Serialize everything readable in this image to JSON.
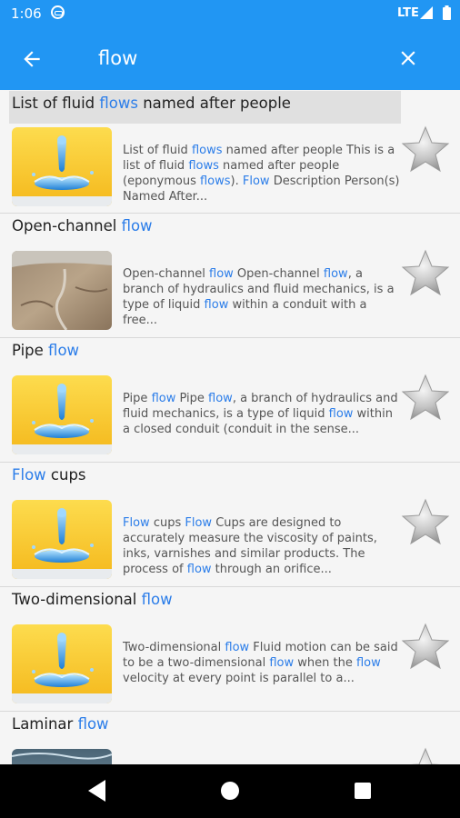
{
  "status_bar": {
    "time": "1:06",
    "network": "LTE"
  },
  "search": {
    "query": "flow",
    "back_icon": "arrow-left-icon",
    "clear_icon": "close-icon"
  },
  "colors": {
    "primary": "#2196f3",
    "highlight": "#2b7de9"
  },
  "results": [
    {
      "title": "List of fluid flows named after people",
      "description": "List of fluid flows named after people This is a list of fluid flows named after people (eponymous flows). Flow Description Person(s) Named After...",
      "thumbnail": "fluid-drop"
    },
    {
      "title": "Open-channel flow",
      "description": "Open-channel flow Open-channel flow, a branch of hydraulics and fluid mechanics, is a type of liquid flow within a conduit with a free...",
      "thumbnail": "landscape"
    },
    {
      "title": "Pipe flow",
      "description": "Pipe flow Pipe flow, a branch of hydraulics and fluid mechanics, is a type of liquid flow within a closed conduit (conduit in the sense...",
      "thumbnail": "fluid-drop"
    },
    {
      "title": "Flow cups",
      "description": "Flow cups Flow Cups are designed to accurately measure the viscosity of paints, inks, varnishes and similar products. The process of flow through an orifice...",
      "thumbnail": "fluid-drop"
    },
    {
      "title": "Two-dimensional flow",
      "description": "Two-dimensional flow Fluid motion can be said to be a two-dimensional flow when the flow velocity at every point is parallel to a...",
      "thumbnail": "fluid-drop"
    },
    {
      "title": "Laminar flow",
      "description": "",
      "thumbnail": "water"
    }
  ],
  "nav_bar": {
    "icons": [
      "back-triangle-icon",
      "home-circle-icon",
      "recents-square-icon"
    ]
  }
}
